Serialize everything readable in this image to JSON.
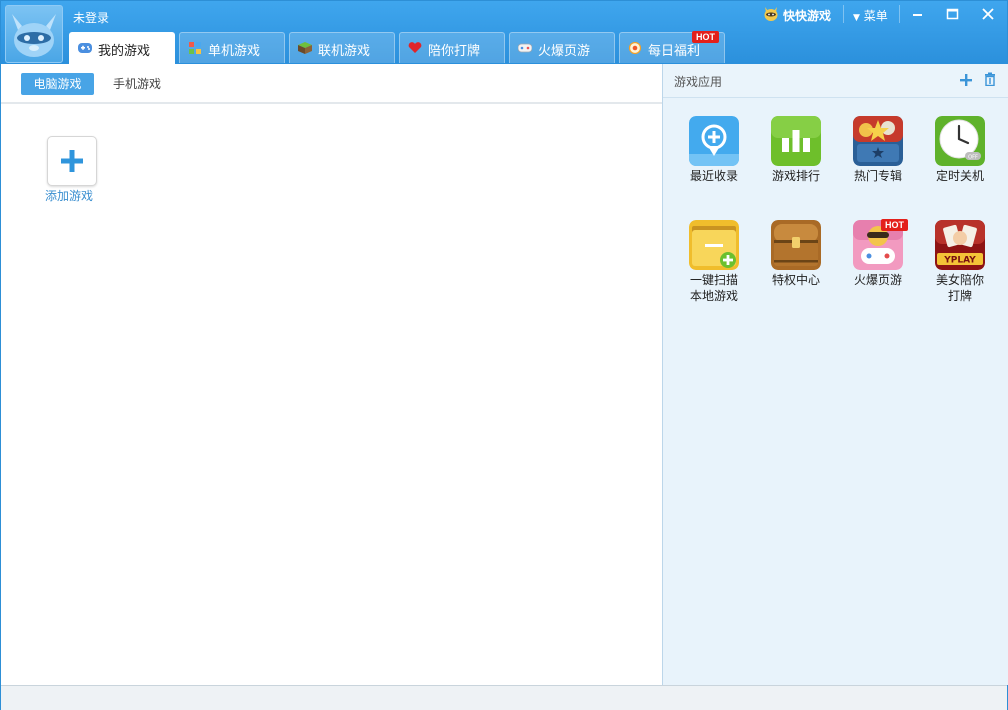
{
  "header": {
    "login_status": "未登录",
    "brand_label": "快快游戏",
    "menu_label": "菜单"
  },
  "tabs": [
    {
      "label": "我的游戏",
      "icon": "gamepad-icon",
      "active": true
    },
    {
      "label": "单机游戏",
      "icon": "colored-squares-icon"
    },
    {
      "label": "联机游戏",
      "icon": "cube-icon"
    },
    {
      "label": "陪你打牌",
      "icon": "heart-icon"
    },
    {
      "label": "火爆页游",
      "icon": "controller-icon"
    },
    {
      "label": "每日福利",
      "icon": "coin-icon",
      "badge": "HOT"
    }
  ],
  "subtabs": [
    {
      "label": "电脑游戏",
      "active": true
    },
    {
      "label": "手机游戏"
    }
  ],
  "left": {
    "add_game_label": "添加游戏"
  },
  "right": {
    "title": "游戏应用",
    "apps": [
      {
        "label": "最近收录",
        "icon": "location-plus-icon",
        "color": "#3fa7ec"
      },
      {
        "label": "游戏排行",
        "icon": "bar-chart-icon",
        "color": "#6cbf2a"
      },
      {
        "label": "热门专辑",
        "icon": "game-album-icon",
        "color": "#2a5f97"
      },
      {
        "label": "定时关机",
        "icon": "clock-icon",
        "color": "#63b52c"
      },
      {
        "label": "一键扫描本地游戏",
        "label_line1": "一键扫描",
        "label_line2": "本地游戏",
        "icon": "folder-plus-icon",
        "color": "#f2c23a"
      },
      {
        "label": "特权中心",
        "icon": "treasure-chest-icon",
        "color": "#b5782e"
      },
      {
        "label": "火爆页游",
        "icon": "cartoon-gamepad-icon",
        "color": "#f09abf",
        "badge": "HOT"
      },
      {
        "label": "美女陪你打牌",
        "label_line1": "美女陪你",
        "label_line2": "打牌",
        "icon": "yplay-cards-icon",
        "color": "#9d1a1a",
        "logo_text": "YPLAY"
      }
    ]
  },
  "colors": {
    "title_bar": "#2f96e2",
    "active_subtab": "#48a4e6",
    "hot_badge": "#e3201b",
    "right_panel_bg": "#e8f3fb"
  }
}
